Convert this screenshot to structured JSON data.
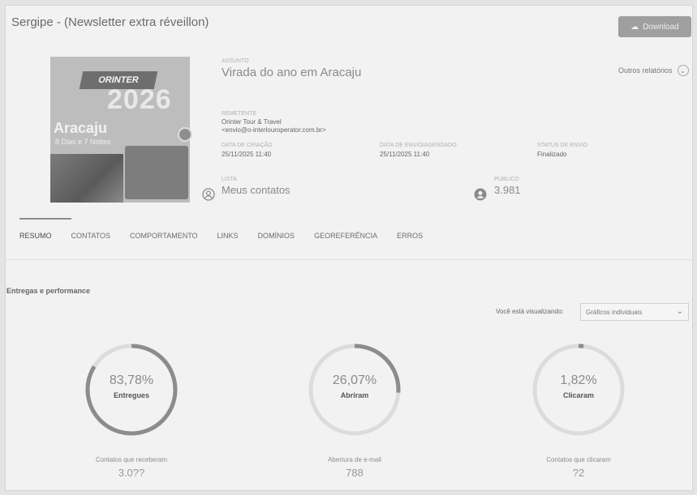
{
  "header": {
    "title": "Sergipe - (Newsletter extra réveillon)",
    "download_label": "Download"
  },
  "cover": {
    "brand": "ORINTER",
    "year": "2026",
    "city": "Aracaju",
    "days": "8 Dias e 7 Noites"
  },
  "meta": {
    "subject_label": "Assunto",
    "subject": "Virada do ano em Aracaju",
    "sender_label": "Remetente",
    "sender_name": "Orinter Tour & Travel",
    "sender_email": "<envio@o-interlouroperator.com.br>",
    "created_label": "Data de criação",
    "created": "25/11/2025 11:40",
    "sent_label": "Data de envio/agendado",
    "sent": "25/11/2025 11:40",
    "status_label": "Status de envio",
    "status": "Finalizado",
    "list_label": "Lista",
    "list": "Meus contatos",
    "audience_label": "Público",
    "audience": "3.981",
    "other_reports": "Outros relatórios"
  },
  "tabs": [
    {
      "label": "RESUMO"
    },
    {
      "label": "CONTATOS"
    },
    {
      "label": "COMPORTAMENTO"
    },
    {
      "label": "LINKS"
    },
    {
      "label": "DOMÍNIOS"
    },
    {
      "label": "GEOREFERÊNCIA"
    },
    {
      "label": "ERROS"
    }
  ],
  "section": {
    "title": "Entregas e performance",
    "viewing_label": "Você está visualizando:",
    "viewing_value": "Gráficos individuais"
  },
  "stats": [
    {
      "percent": "83,78%",
      "percent_value": 83.78,
      "name": "Entregues",
      "label": "Contatos que receberam",
      "value": "3.0??"
    },
    {
      "percent": "26,07%",
      "percent_value": 26.07,
      "name": "Abriram",
      "label": "Abertura de e-mail",
      "value": "788"
    },
    {
      "percent": "1,82%",
      "percent_value": 1.82,
      "name": "Clicaram",
      "label": "Contatos que clicaram",
      "value": "?2"
    }
  ],
  "colors": {
    "ring_fill": "#8c8c8c",
    "ring_track": "#dcdcdc"
  }
}
